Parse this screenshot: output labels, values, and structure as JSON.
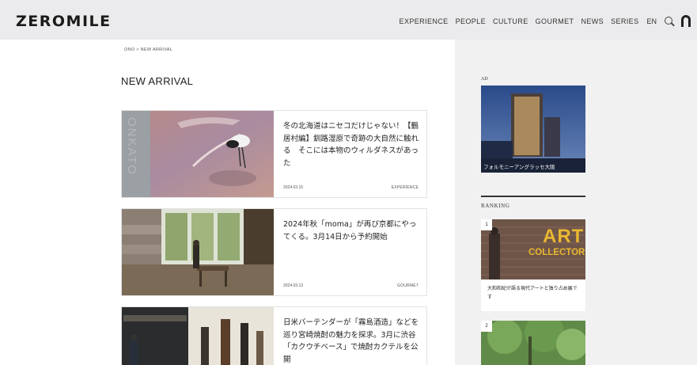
{
  "header": {
    "logo": "ZEROMILE",
    "nav": [
      "EXPERIENCE",
      "PEOPLE",
      "CULTURE",
      "GOURMET",
      "NEWS",
      "SERIES"
    ],
    "lang": "EN"
  },
  "main": {
    "breadcrumb": "ONO > NEW ARRIVAL",
    "title": "NEW ARRIVAL",
    "articles": [
      {
        "title": "冬の北海道はニセコだけじゃない！【鶴居村編】釧路湿原で奇跡の大自然に触れる　そこには本物のウィルダネスがあった",
        "date": "2024.03.15",
        "category": "EXPERIENCE",
        "thumb_side_text": "ONKATO"
      },
      {
        "title": "2024年秋「moma」が再び京都にやってくる。3月14日から予約開始",
        "date": "2024.03.13",
        "category": "GOURMET"
      },
      {
        "title": "日米バーテンダーが「霧島酒造」などを巡り宮崎焼酎の魅力を探求。3月に渋谷「カクウチベース」で焼酎カクテルを公開",
        "date": "",
        "category": ""
      }
    ]
  },
  "sidebar": {
    "ad_label": "AD",
    "ad_caption": "フォルモニーアングラッセ大阪",
    "ranking_title": "RANKING",
    "ranking": [
      {
        "rank": "1",
        "art_word_1": "ART",
        "art_word_2": "COLLECTOR",
        "caption": "大和和紀が語る現代アートと独り占め展です"
      },
      {
        "rank": "2"
      }
    ]
  },
  "colors": {
    "header_bg": "#ebebed",
    "sidebar_bg": "#f1f1f2",
    "accent_gold": "#e9b731"
  }
}
